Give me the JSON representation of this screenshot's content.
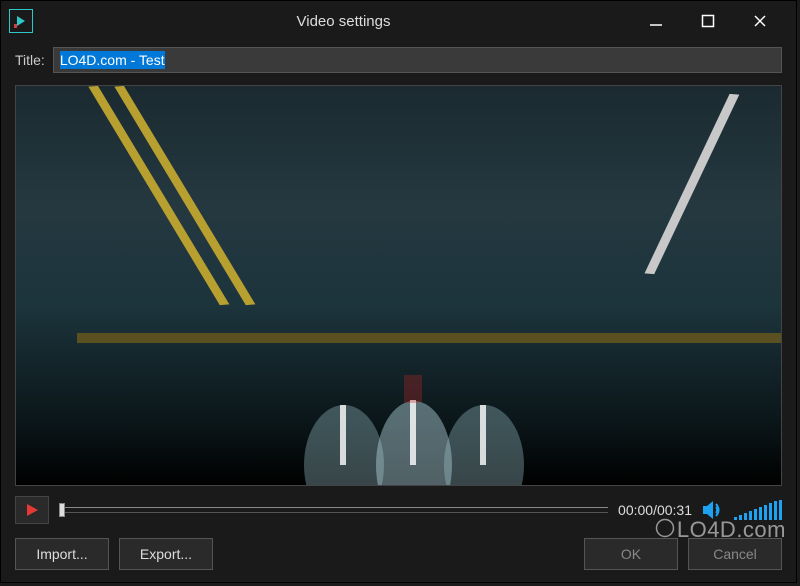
{
  "window": {
    "title": "Video settings"
  },
  "form": {
    "title_label": "Title:",
    "title_value": "LO4D.com - Test"
  },
  "playback": {
    "current_time": "00:00",
    "total_time": "00:31",
    "time_display": "00:00/00:31"
  },
  "buttons": {
    "import": "Import...",
    "export": "Export...",
    "ok": "OK",
    "cancel": "Cancel"
  },
  "icons": {
    "app": "vsdc-icon",
    "minimize": "minimize-icon",
    "maximize": "maximize-icon",
    "close": "close-icon",
    "play": "play-icon",
    "volume": "volume-icon"
  },
  "colors": {
    "accent": "#2ec8c8",
    "volume": "#1da1f2",
    "play": "#e53935",
    "selection": "#0078d7"
  },
  "watermark": "LO4D.com"
}
